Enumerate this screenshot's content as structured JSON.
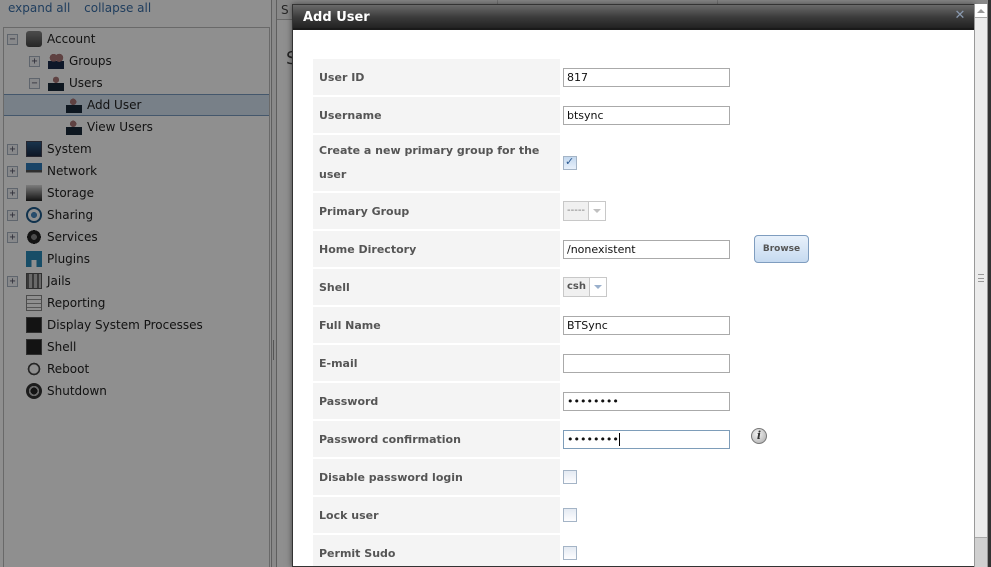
{
  "tree_links": {
    "expand_all": "expand all",
    "collapse_all": "collapse all"
  },
  "tree": [
    {
      "label": "Account",
      "expander": "−",
      "icon": "account-icon",
      "level": 0
    },
    {
      "label": "Groups",
      "expander": "+",
      "icon": "groups-icon",
      "level": 1
    },
    {
      "label": "Users",
      "expander": "−",
      "icon": "user-icon",
      "level": 1
    },
    {
      "label": "Add User",
      "expander": "",
      "icon": "add-user-icon",
      "level": 2,
      "selected": true
    },
    {
      "label": "View Users",
      "expander": "",
      "icon": "view-users-icon",
      "level": 2
    },
    {
      "label": "System",
      "expander": "+",
      "icon": "system-icon",
      "level": 0
    },
    {
      "label": "Network",
      "expander": "+",
      "icon": "network-icon",
      "level": 0
    },
    {
      "label": "Storage",
      "expander": "+",
      "icon": "storage-icon",
      "level": 0
    },
    {
      "label": "Sharing",
      "expander": "+",
      "icon": "sharing-icon",
      "level": 0
    },
    {
      "label": "Services",
      "expander": "+",
      "icon": "services-icon",
      "level": 0
    },
    {
      "label": "Plugins",
      "expander": "",
      "icon": "plugins-icon",
      "level": 0
    },
    {
      "label": "Jails",
      "expander": "+",
      "icon": "jails-icon",
      "level": 0
    },
    {
      "label": "Reporting",
      "expander": "",
      "icon": "reporting-icon",
      "level": 0
    },
    {
      "label": "Display System Processes",
      "expander": "",
      "icon": "processes-icon",
      "level": 0
    },
    {
      "label": "Shell",
      "expander": "",
      "icon": "shell-icon",
      "level": 0
    },
    {
      "label": "Reboot",
      "expander": "",
      "icon": "reboot-icon",
      "level": 0
    },
    {
      "label": "Shutdown",
      "expander": "",
      "icon": "shutdown-icon",
      "level": 0
    }
  ],
  "background": {
    "tab_partial": "S",
    "heading_partial": "S"
  },
  "dialog": {
    "title": "Add User",
    "close_glyph": "✕",
    "fields": {
      "user_id": {
        "label": "User ID",
        "value": "817"
      },
      "username": {
        "label": "Username",
        "value": "btsync"
      },
      "create_group": {
        "label": "Create a new primary group for the user",
        "checked": true
      },
      "primary_group": {
        "label": "Primary Group",
        "value": "-----"
      },
      "home_dir": {
        "label": "Home Directory",
        "value": "/nonexistent",
        "button": "Browse"
      },
      "shell": {
        "label": "Shell",
        "value": "csh"
      },
      "full_name": {
        "label": "Full Name",
        "value": "BTSync"
      },
      "email": {
        "label": "E-mail",
        "value": ""
      },
      "password": {
        "label": "Password",
        "value": "••••••••"
      },
      "password_confirm": {
        "label": "Password confirmation",
        "value": "••••••••",
        "info_glyph": "i"
      },
      "disable_pw_login": {
        "label": "Disable password login",
        "checked": false
      },
      "lock_user": {
        "label": "Lock user",
        "checked": false
      },
      "permit_sudo": {
        "label": "Permit Sudo",
        "checked": false
      }
    }
  }
}
